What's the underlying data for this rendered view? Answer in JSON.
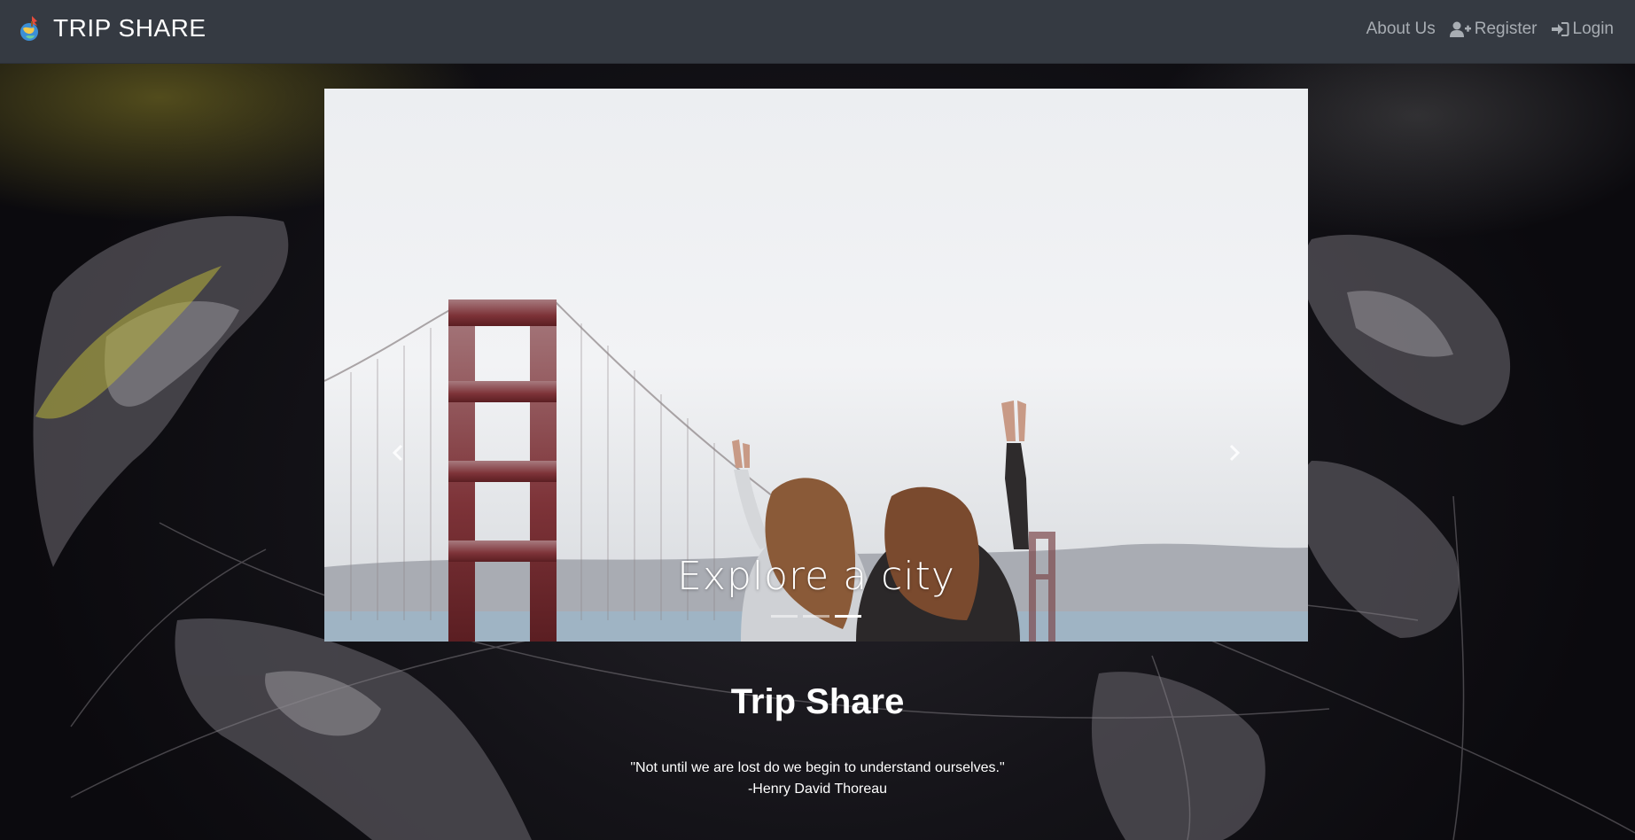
{
  "navbar": {
    "brand": "TRIP SHARE",
    "links": [
      {
        "label": "About Us",
        "icon": "none"
      },
      {
        "label": "Register",
        "icon": "user-plus-icon"
      },
      {
        "label": "Login",
        "icon": "sign-in-icon"
      }
    ]
  },
  "carousel": {
    "caption": "Explore a city",
    "slide_count": 3,
    "active_slide": 3
  },
  "hero": {
    "title": "Trip Share",
    "quote": "\"Not until we are lost do we begin to understand ourselves.\"",
    "author": "-Henry David Thoreau"
  },
  "colors": {
    "navbar_bg": "#353a42",
    "nav_link": "#a8adb3",
    "text": "#ffffff"
  }
}
